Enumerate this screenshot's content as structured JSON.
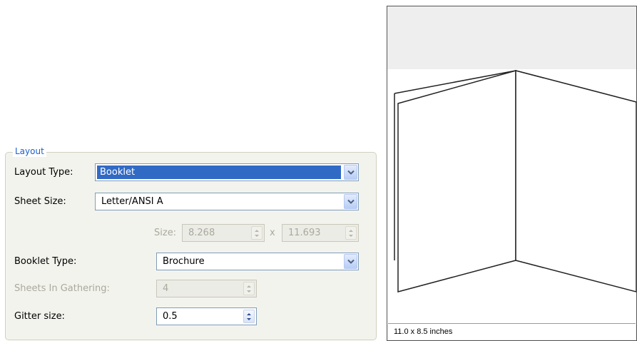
{
  "layout_group": {
    "title": "Layout",
    "layout_type": {
      "label": "Layout Type:",
      "value": "Booklet"
    },
    "sheet_size": {
      "label": "Sheet Size:",
      "value": "Letter/ANSI A"
    },
    "custom_size": {
      "label": "Size:",
      "width": "8.268",
      "separator": "x",
      "height": "11.693"
    },
    "booklet_type": {
      "label": "Booklet Type:",
      "value": "Brochure"
    },
    "sheets_in_gathering": {
      "label": "Sheets In Gathering:",
      "value": "4"
    },
    "gitter_size": {
      "label": "Gitter size:",
      "value": "0.5"
    }
  },
  "preview": {
    "caption": "11.0 x 8.5 inches"
  },
  "icons": {
    "dropdown": "chevron-down-icon",
    "spinner": "spin-arrows-icon"
  },
  "colors": {
    "accent": "#316ac5",
    "legend": "#1f5fd0",
    "disabled_text": "#a9a99d"
  }
}
